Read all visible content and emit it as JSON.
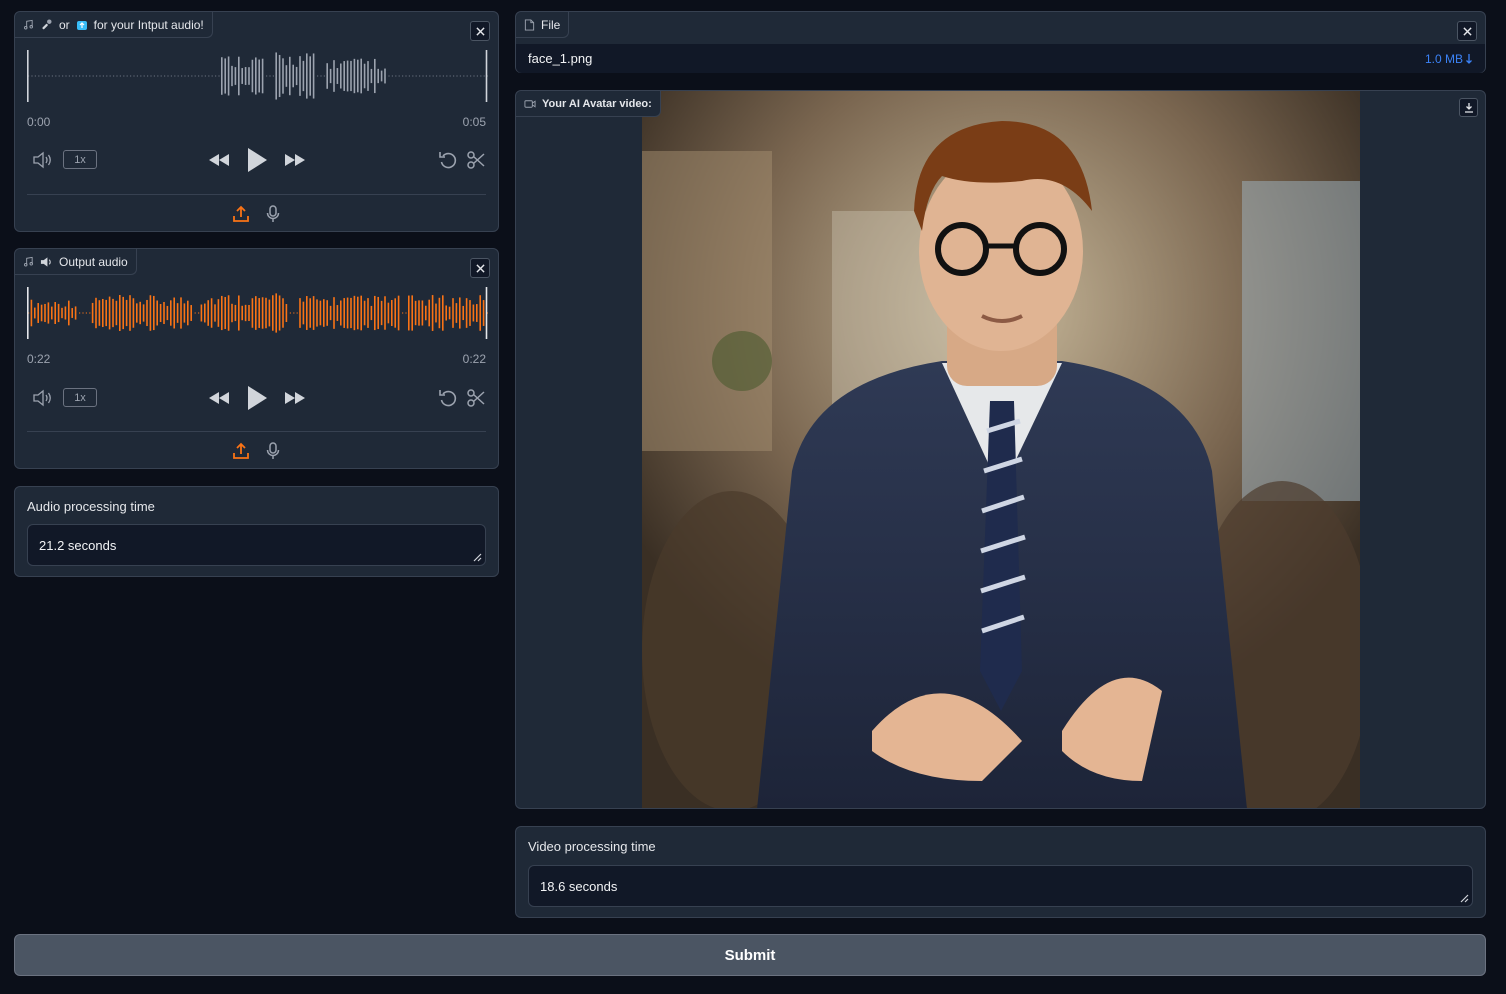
{
  "input_audio": {
    "label": "for your Intput audio!",
    "label_or": "or",
    "time_start": "0:00",
    "time_end": "0:05",
    "playback_rate": "1x",
    "colors": {
      "wave": "#9ca3af"
    }
  },
  "output_audio": {
    "label": "Output audio",
    "time_start": "0:22",
    "time_end": "0:22",
    "playback_rate": "1x",
    "colors": {
      "wave": "#f97316"
    }
  },
  "audio_processing": {
    "label": "Audio processing time",
    "value": "21.2 seconds"
  },
  "file": {
    "label": "File",
    "filename": "face_1.png",
    "size": "1.0 MB",
    "size_icon": "download-arrow-icon"
  },
  "video": {
    "label": "Your AI Avatar video:"
  },
  "video_processing": {
    "label": "Video processing time",
    "value": "18.6 seconds"
  },
  "submit_label": "Submit",
  "colors": {
    "accent": "#f97316",
    "link": "#3b82f6",
    "background": "#0b0f19",
    "panel": "#1f2937"
  }
}
